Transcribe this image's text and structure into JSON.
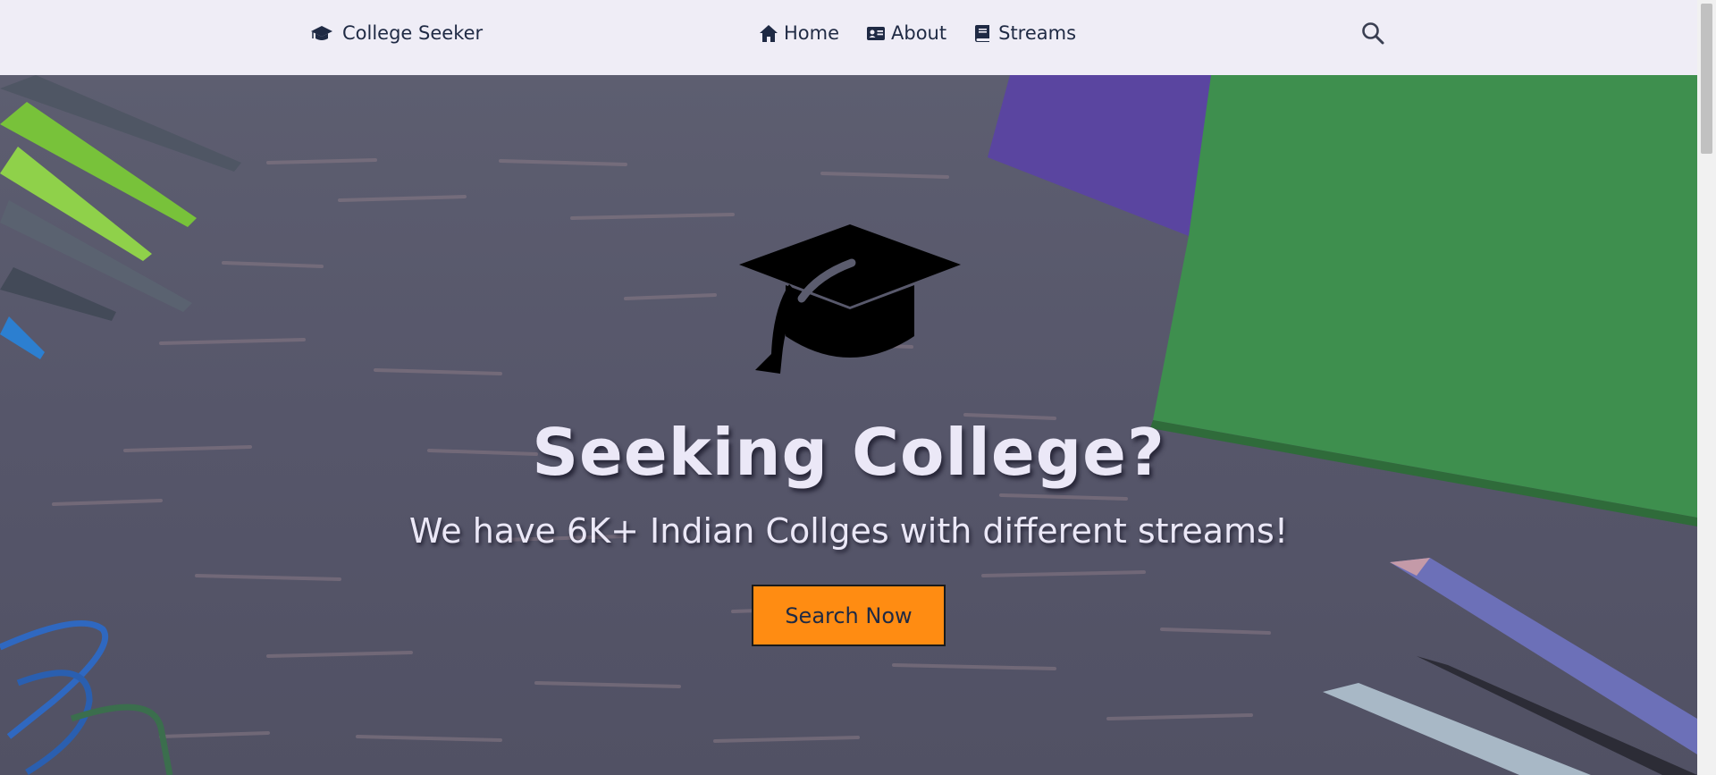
{
  "navbar": {
    "brand_label": "College Seeker",
    "brand_icon": "graduation-cap-icon",
    "links": [
      {
        "label": "Home",
        "icon": "home-icon"
      },
      {
        "label": "About",
        "icon": "id-card-icon"
      },
      {
        "label": "Streams",
        "icon": "book-icon"
      }
    ],
    "search_icon": "search-icon"
  },
  "hero": {
    "icon": "graduation-cap-icon",
    "title": "Seeking College?",
    "subtitle": "We have 6K+ Indian Collges with different streams!",
    "button_label": "Search Now"
  },
  "colors": {
    "nav_bg": "#efedf6",
    "nav_text": "#1f2a44",
    "hero_text": "#ebe8f7",
    "button_bg": "#ff8c12"
  }
}
